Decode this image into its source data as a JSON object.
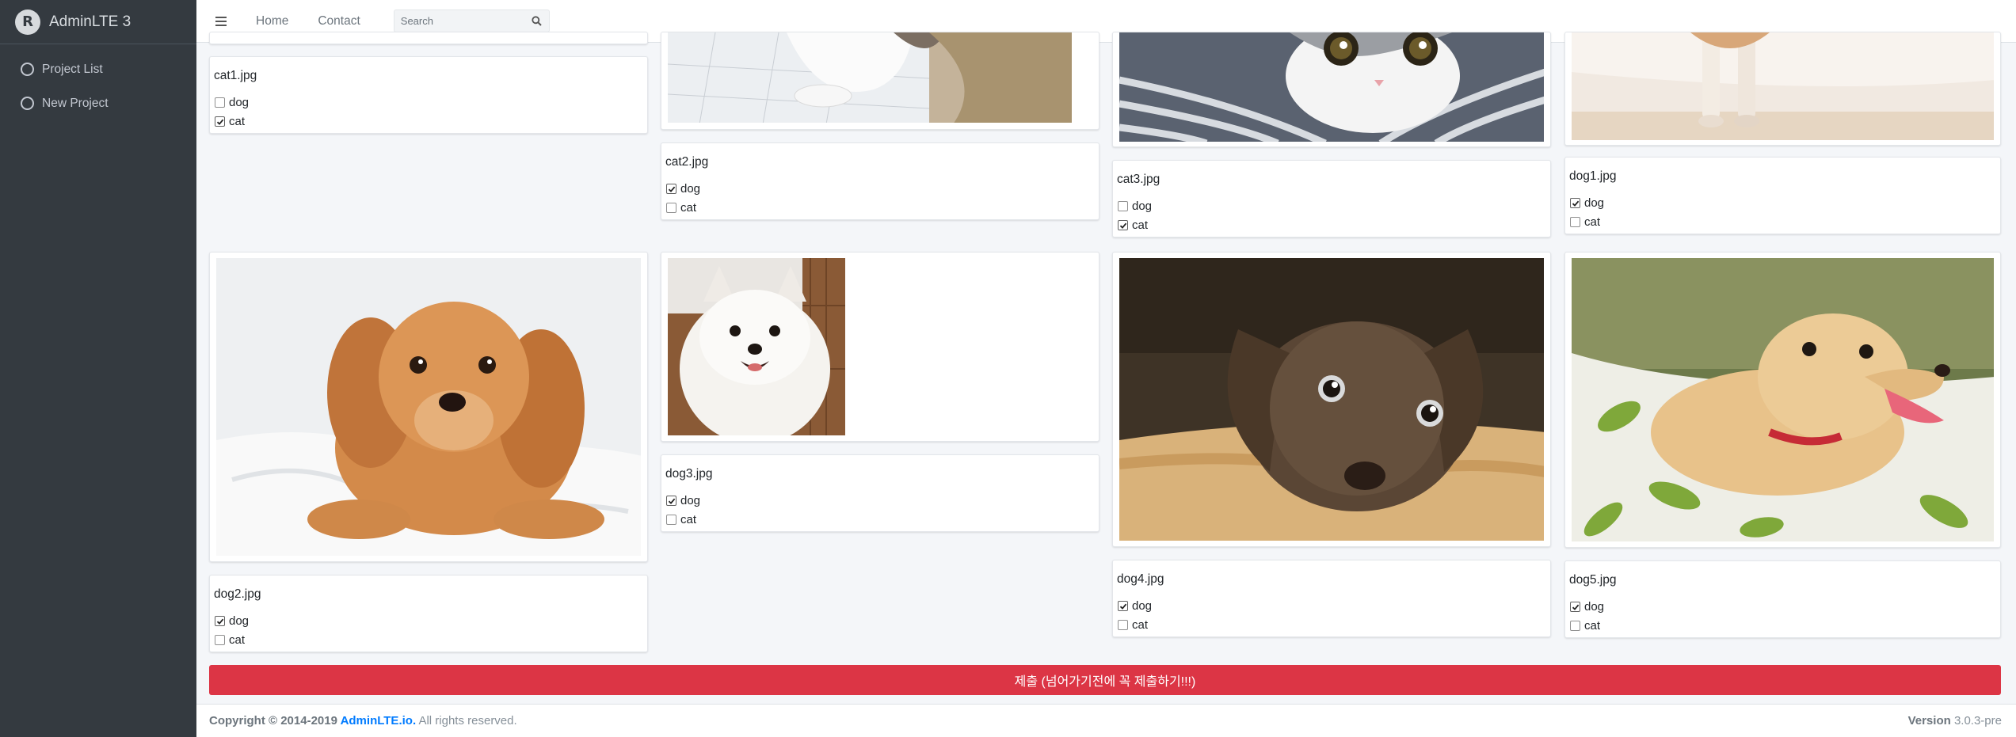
{
  "brand": {
    "title": "AdminLTE 3",
    "logo_letter": "R"
  },
  "sidebar": {
    "items": [
      {
        "label": "Project List"
      },
      {
        "label": "New Project"
      }
    ]
  },
  "header": {
    "nav": [
      {
        "label": "Home"
      },
      {
        "label": "Contact"
      }
    ],
    "search": {
      "placeholder": "Search",
      "value": ""
    }
  },
  "labels": [
    "dog",
    "cat"
  ],
  "images": [
    {
      "file": "cat1.jpg",
      "dog": false,
      "cat": true
    },
    {
      "file": "cat2.jpg",
      "dog": true,
      "cat": false
    },
    {
      "file": "cat3.jpg",
      "dog": false,
      "cat": true
    },
    {
      "file": "dog1.jpg",
      "dog": true,
      "cat": false
    },
    {
      "file": "dog2.jpg",
      "dog": true,
      "cat": false
    },
    {
      "file": "dog3.jpg",
      "dog": true,
      "cat": false
    },
    {
      "file": "dog4.jpg",
      "dog": true,
      "cat": false
    },
    {
      "file": "dog5.jpg",
      "dog": true,
      "cat": false
    }
  ],
  "submit": {
    "label": "제출 (넘어가기전에 꼭 제출하기!!!)",
    "color": "#dc3545"
  },
  "footer": {
    "copyright_prefix": "Copyright © 2014-2019 ",
    "copyright_link": "AdminLTE.io.",
    "copyright_suffix": " All rights reserved.",
    "version_label": "Version",
    "version_value": " 3.0.3-pre"
  },
  "colors": {
    "sidebar_bg": "#343a40",
    "link": "#007bff",
    "danger": "#dc3545",
    "page_bg": "#f4f6f9"
  }
}
